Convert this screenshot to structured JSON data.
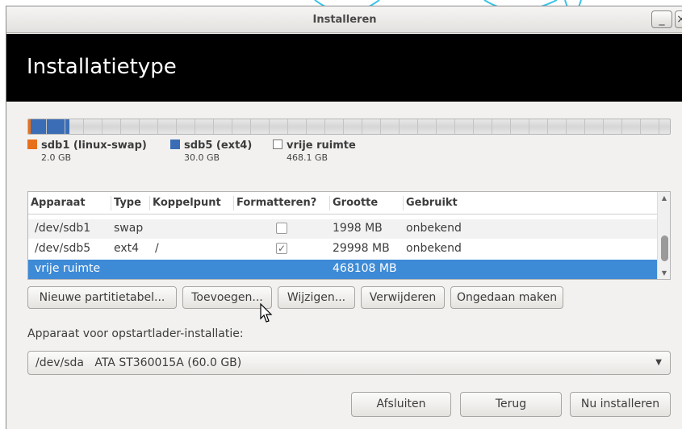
{
  "window": {
    "title": "Installeren",
    "minimize_glyph": "_",
    "close_glyph": "×"
  },
  "header": {
    "heading": "Installatietype"
  },
  "partition_bar": {
    "segments": [
      {
        "name": "sdb1",
        "color": "#e8701a",
        "fraction": 0.004
      },
      {
        "name": "sdb5",
        "color": "#3a6db5",
        "fraction": 0.06
      },
      {
        "name": "free",
        "color": "#d8d8d8",
        "fraction": 0.936
      }
    ]
  },
  "legend": [
    {
      "label": "sdb1 (linux-swap)",
      "size": "2.0 GB",
      "color": "#e8701a",
      "icon": "orange-square-icon"
    },
    {
      "label": "sdb5 (ext4)",
      "size": "30.0 GB",
      "color": "#3a6db5",
      "icon": "blue-square-icon"
    },
    {
      "label": "vrije ruimte",
      "size": "468.1 GB",
      "color": "#ffffff",
      "icon": "empty-square-icon"
    }
  ],
  "table": {
    "columns": [
      "Apparaat",
      "Type",
      "Koppelpunt",
      "Formatteren?",
      "Grootte",
      "Gebruikt"
    ],
    "rows": [
      {
        "device": "/dev/sdb1",
        "type": "swap",
        "mount": "",
        "format": false,
        "size": "1998 MB",
        "used": "onbekend"
      },
      {
        "device": "/dev/sdb5",
        "type": "ext4",
        "mount": "/",
        "format": true,
        "size": "29998 MB",
        "used": "onbekend"
      },
      {
        "device": "vrije ruimte",
        "type": "",
        "mount": "",
        "format": false,
        "size": "468108 MB",
        "used": "",
        "selected": true
      }
    ]
  },
  "partition_buttons": {
    "new_table": "Nieuwe partitietabel...",
    "add": "Toevoegen...",
    "change": "Wijzigen...",
    "delete": "Verwijderen",
    "undo": "Ongedaan maken"
  },
  "bootloader": {
    "label": "Apparaat voor opstartlader-installatie:",
    "device": "/dev/sda",
    "description": "ATA ST360015A (60.0 GB)"
  },
  "footer_buttons": {
    "quit": "Afsluiten",
    "back": "Terug",
    "install": "Nu installeren"
  },
  "colors": {
    "selection": "#3d8ad7",
    "header_bg": "#000000",
    "window_bg": "#f2f1f0"
  }
}
